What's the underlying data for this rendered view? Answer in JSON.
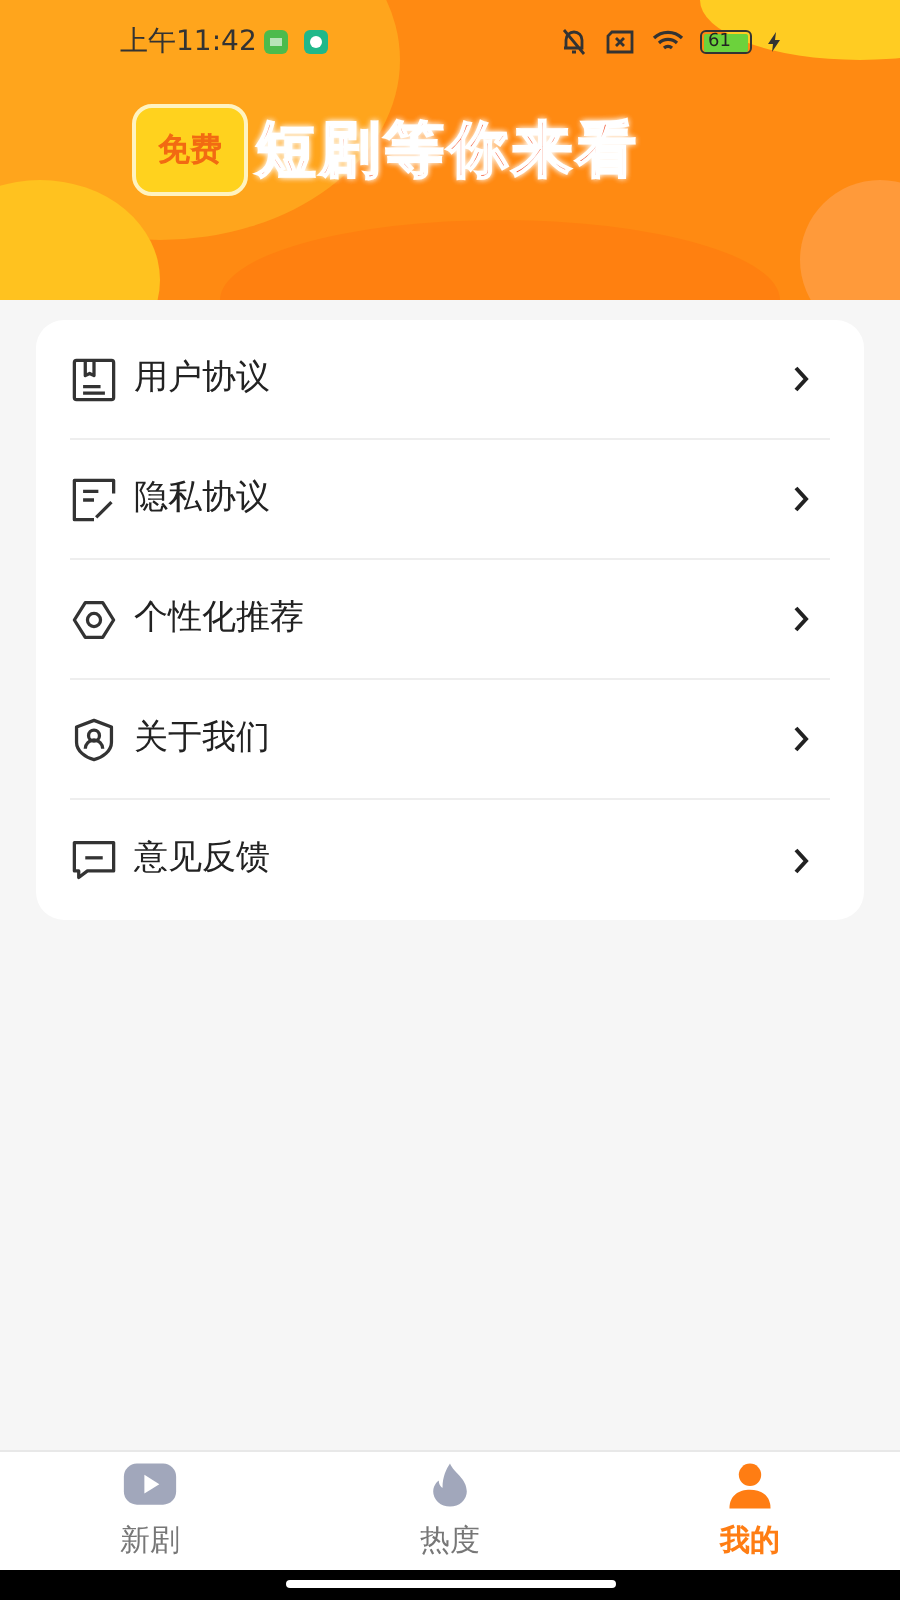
{
  "status_bar": {
    "time": "上午11:42",
    "battery": "61"
  },
  "banner": {
    "badge": "免费",
    "slogan": "短剧等你来看"
  },
  "menu": [
    {
      "label": "用户协议"
    },
    {
      "label": "隐私协议"
    },
    {
      "label": "个性化推荐"
    },
    {
      "label": "关于我们"
    },
    {
      "label": "意见反馈"
    }
  ],
  "tabs": [
    {
      "label": "新剧",
      "selected": false
    },
    {
      "label": "热度",
      "selected": false
    },
    {
      "label": "我的",
      "selected": true
    }
  ]
}
